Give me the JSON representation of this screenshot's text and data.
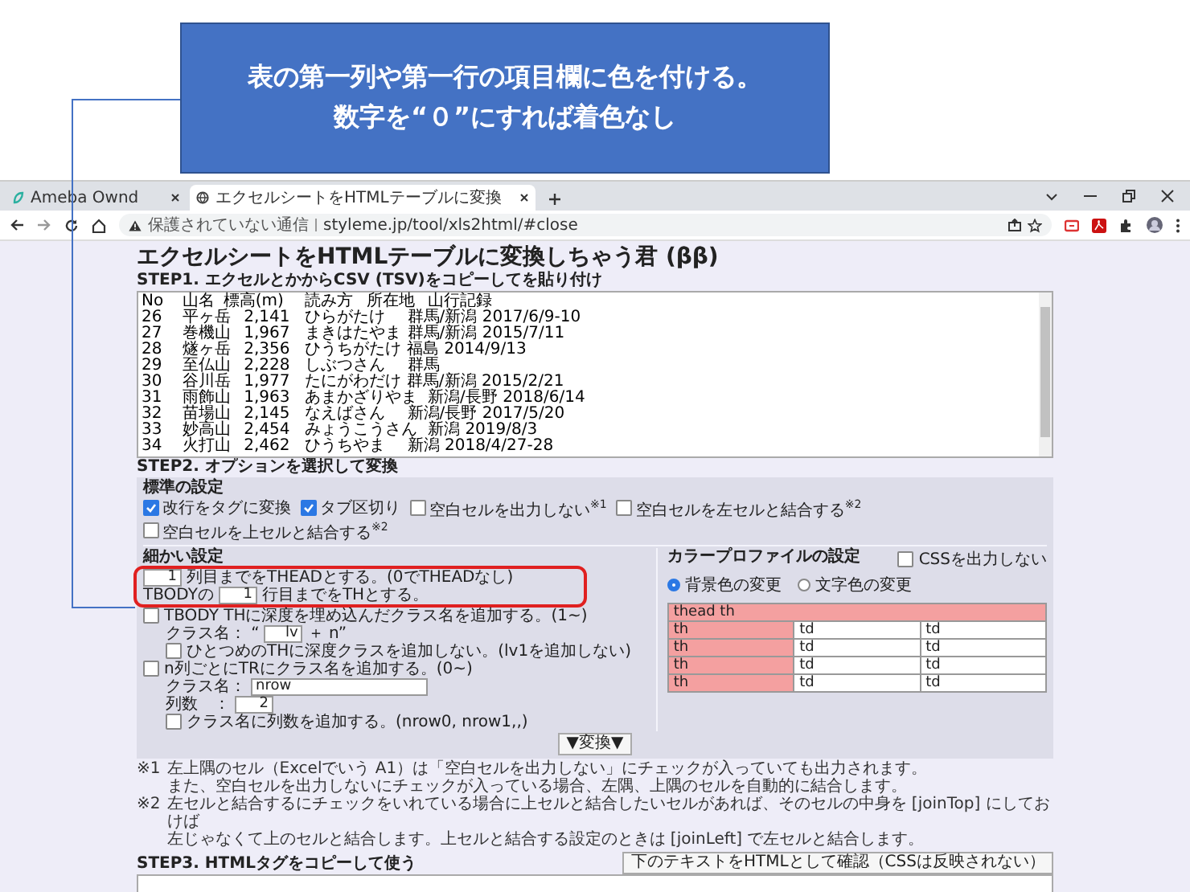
{
  "callout": {
    "lines": [
      "表の第一列や第一行の項目欄に色を付ける。",
      "数字を“０”にすれば着色なし"
    ]
  },
  "browser": {
    "tabs": [
      {
        "title": "Ameba Ownd",
        "selected": false
      },
      {
        "title": "エクセルシートをHTMLテーブルに変換",
        "selected": true
      }
    ],
    "security_label": "保護されていない通信",
    "url": "styleme.jp/tool/xls2html/#close"
  },
  "page": {
    "title": "エクセルシートをHTMLテーブルに変換しちゃう君 (ββ)",
    "step1": {
      "heading": "STEP1. エクセルとかからCSV (TSV)をコピーしてを貼り付け",
      "lines": [
        "No\t山名\t標高(m)\t読み方\t所在地\t山行記録",
        "26\t平ヶ岳\t2,141\tひらがたけ\t群馬/新潟 2017/6/9-10",
        "27\t巻機山\t1,967\tまきはたやま\t群馬/新潟 2015/7/11",
        "28\t燧ヶ岳\t2,356\tひうちがたけ 福島 2014/9/13",
        "29\t至仏山\t2,228\tしぶつさん\t群馬",
        "30\t谷川岳\t1,977\tたにがわだけ 群馬/新潟 2015/2/21",
        "31\t雨飾山\t1,963\tあまかざりやま\t新潟/長野 2018/6/14",
        "32\t苗場山\t2,145\tなえばさん\t新潟/長野 2017/5/20",
        "33\t妙高山\t2,454\tみょうこうさん\t新潟 2019/8/3",
        "34\t火打山\t2,462\tひうちやま\t新潟 2018/4/27-28"
      ]
    },
    "step2": {
      "heading": "STEP2. オプションを選択して変換",
      "standard": {
        "heading": "標準の設定",
        "options": [
          {
            "label": "改行をタグに変換",
            "checked": true
          },
          {
            "label": "タブ区切り",
            "checked": true
          },
          {
            "label": "空白セルを出力しない$^{※1}$",
            "checked": false
          },
          {
            "label": "空白セルを左セルと結合する$^{※2}$",
            "checked": false
          },
          {
            "label": "空白セルを上セルと結合する$^{※2}$",
            "checked": false
          }
        ]
      },
      "details": {
        "heading": "細かい設定",
        "highlighted": [
          {
            "kind": "number_input",
            "value": "1",
            "suffix": "列目までをTHEADとする。(0でTHEADなし)"
          },
          {
            "kind": "number_input",
            "prefix": "TBODYの",
            "value": "1",
            "suffix": "行目までをTHとする。"
          }
        ],
        "items": [
          {
            "kind": "checkbox",
            "label": "TBODY THに深度を埋め込んだクラス名を追加する。(1~)",
            "checked": false,
            "children": [
              {
                "kind": "text_short",
                "prefix": "クラス名： “",
                "value": "lv",
                "suffix": "＋ n”"
              },
              {
                "kind": "checkbox",
                "label": "ひとつめのTHに深度クラスを追加しない。(lv1を追加しない)",
                "checked": false
              }
            ]
          },
          {
            "kind": "checkbox",
            "label": "n列ごとにTRにクラス名を追加する。(0~)",
            "checked": false,
            "children": [
              {
                "kind": "text_input",
                "prefix": "クラス名：",
                "value": "nrow"
              },
              {
                "kind": "number_input",
                "prefix": "列数　：",
                "value": "2"
              },
              {
                "kind": "checkbox",
                "label": "クラス名に列数を追加する。(nrow0, nrow1,,)",
                "checked": false
              }
            ]
          }
        ]
      },
      "color_profile": {
        "heading": "カラープロファイルの設定",
        "css_option": {
          "label": "CSSを出力しない",
          "checked": false
        },
        "modes": [
          {
            "label": "背景色の変更",
            "selected": true
          },
          {
            "label": "文字色の変更",
            "selected": false
          }
        ],
        "preview": {
          "header": "thead th",
          "rows": [
            [
              "th",
              "td",
              "td"
            ],
            [
              "th",
              "td",
              "td"
            ],
            [
              "th",
              "td",
              "td"
            ],
            [
              "th",
              "td",
              "td"
            ]
          ]
        }
      },
      "convert_button": "▼変換▼"
    },
    "notes": [
      {
        "mark": "※1",
        "lines": [
          "左上隅のセル（Excelでいう A1）は「空白セルを出力しない」にチェックが入っていても出力されます。",
          "また、空白セルを出力しないにチェックが入っている場合、左隅、上隅のセルを自動的に結合します。"
        ]
      },
      {
        "mark": "※2",
        "lines": [
          "左セルと結合するにチェックをいれている場合に上セルと結合したいセルがあれば、そのセルの中身を [joinTop] にしておけば",
          "左じゃなくて上のセルと結合します。上セルと結合する設定のときは [joinLeft] で左セルと結合します。"
        ]
      }
    ],
    "step3": {
      "heading": "STEP3. HTMLタグをコピーして使う",
      "button": "下のテキストをHTMLとして確認（CSSは反映されない）"
    }
  }
}
